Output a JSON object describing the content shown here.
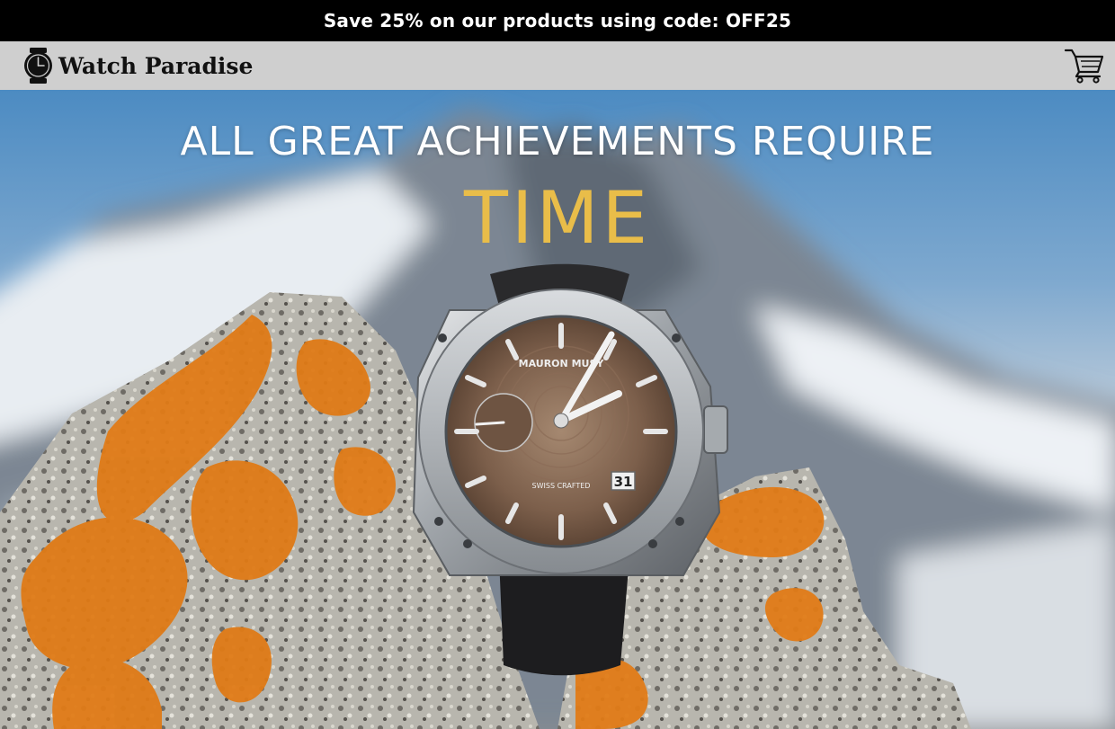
{
  "promo": {
    "text": "Save 25% on our products using code: OFF25"
  },
  "brand": {
    "name": "Watch Paradise",
    "logo_icon": "watch-icon"
  },
  "cart": {
    "icon": "shopping-cart-icon"
  },
  "hero": {
    "headline": "ALL GREAT ACHIEVEMENTS REQUIRE",
    "accent": "TIME",
    "accent_color": "#e9bd49",
    "watch_brand": "MAURON MUSY",
    "watch_text": "SWISS CRAFTED",
    "watch_date": "31"
  },
  "colors": {
    "promo_bg": "#000000",
    "nav_bg": "#cfcfcf"
  }
}
